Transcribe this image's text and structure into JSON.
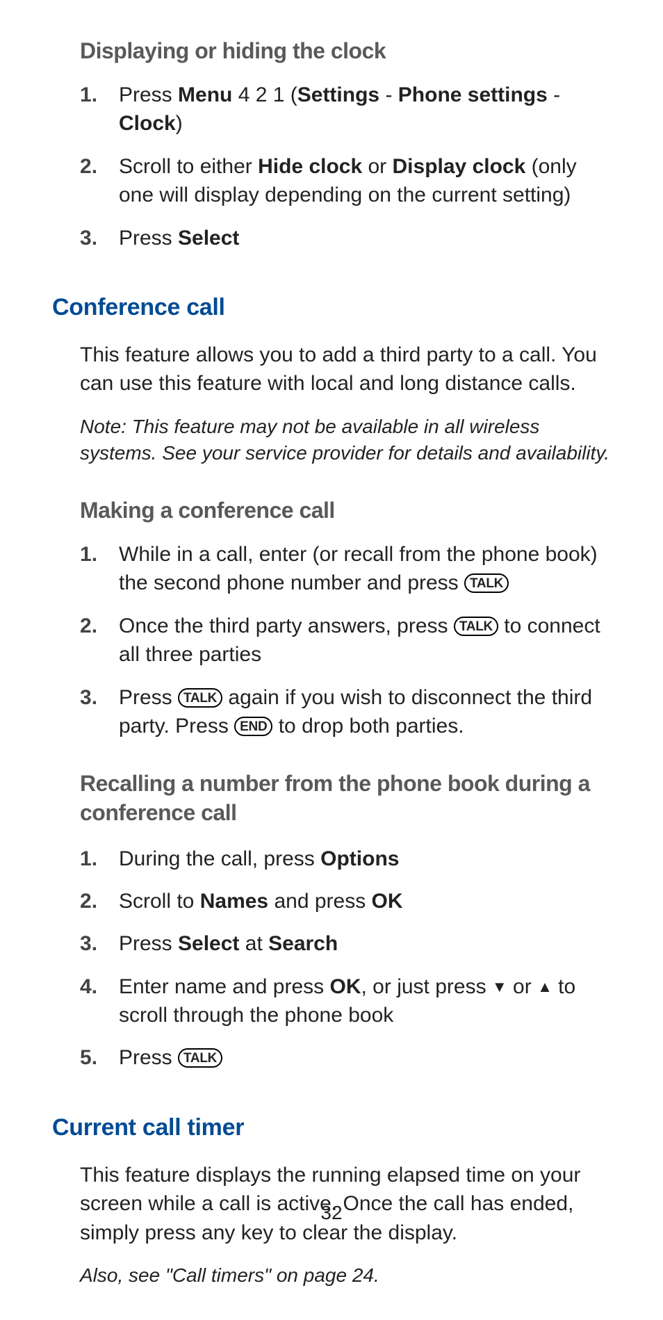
{
  "sec1": {
    "subhead": "Displaying or hiding the clock",
    "step1_a": "Press ",
    "step1_menu": "Menu",
    "step1_b": " 4 2 1 (",
    "step1_settings": "Settings",
    "step1_dash1": " - ",
    "step1_phone": "Phone settings",
    "step1_dash2": " - ",
    "step1_clock": "Clock",
    "step1_c": ")",
    "step2_a": "Scroll to either ",
    "step2_hide": "Hide clock",
    "step2_b": " or ",
    "step2_display": "Display clock",
    "step2_c": " (only one will display depending on the current setting)",
    "step3_a": "Press ",
    "step3_select": "Select"
  },
  "conf": {
    "title": "Conference call",
    "intro": "This feature allows you to add a third party to a call. You can use this feature with local and long distance calls.",
    "note": "Note: This feature may not be available in all wireless systems. See your service provider for details and availability.",
    "making_heading": "Making a conference call",
    "m1_a": "While in a call, enter (or recall from the phone book) the second phone number and press ",
    "key_talk": "TALK",
    "m2_a": "Once the third party answers, press ",
    "m2_b": " to connect all three parties",
    "m3_a": "Press ",
    "m3_b": " again if you wish to disconnect the third party. Press ",
    "key_end": "END",
    "m3_c": " to drop both parties.",
    "recall_heading": "Recalling a number from the phone book during a conference call",
    "r1_a": "During the call, press ",
    "r1_options": "Options",
    "r2_a": "Scroll to ",
    "r2_names": "Names",
    "r2_b": " and press ",
    "r2_ok": "OK",
    "r3_a": "Press ",
    "r3_select": "Select",
    "r3_b": " at ",
    "r3_search": "Search",
    "r4_a": "Enter name and press ",
    "r4_ok": "OK",
    "r4_b": ", or just press ",
    "r4_down": "▼",
    "r4_c": " or ",
    "r4_up": "▲",
    "r4_d": " to scroll through the phone book",
    "r5_a": "Press "
  },
  "timer": {
    "title": "Current call timer",
    "body": "This feature displays the running elapsed time on your screen while a call is active. Once the call has ended, simply press any key to clear the display.",
    "note": "Also, see \"Call timers\" on page 24."
  },
  "pagenum": "32"
}
